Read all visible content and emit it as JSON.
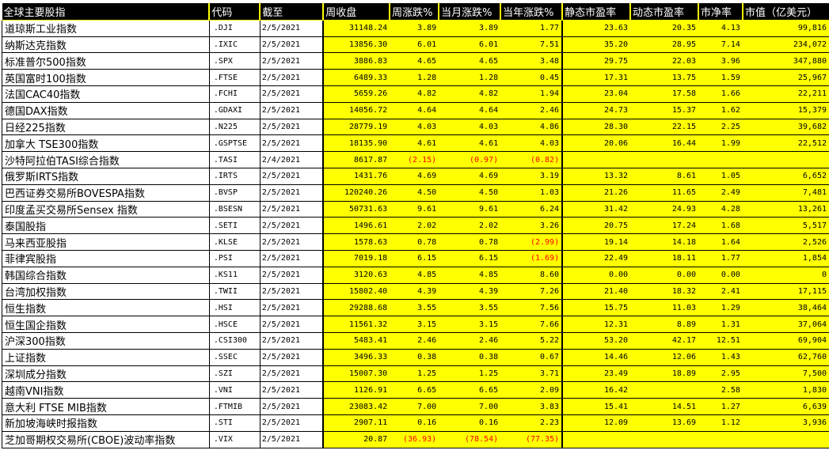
{
  "headers": [
    "全球主要股指",
    "代码",
    "截至",
    "周收盘",
    "周涨跌%",
    "当月涨跌%",
    "当年涨跌%",
    "静态市盈率",
    "动态市盈率",
    "市净率",
    "市值（亿美元）"
  ],
  "rows": [
    {
      "name": "道琼斯工业指数",
      "code": ".DJI",
      "date": "2/5/2021",
      "close": "31148.24",
      "week": "3.89",
      "month": "3.89",
      "year": "1.77",
      "pe": "23.63",
      "fpe": "20.35",
      "pb": "4.13",
      "cap": "99,816"
    },
    {
      "name": "纳斯达克指数",
      "code": ".IXIC",
      "date": "2/5/2021",
      "close": "13856.30",
      "week": "6.01",
      "month": "6.01",
      "year": "7.51",
      "pe": "35.20",
      "fpe": "28.95",
      "pb": "7.14",
      "cap": "234,072"
    },
    {
      "name": "标准普尔500指数",
      "code": ".SPX",
      "date": "2/5/2021",
      "close": "3886.83",
      "week": "4.65",
      "month": "4.65",
      "year": "3.48",
      "pe": "29.75",
      "fpe": "22.03",
      "pb": "3.96",
      "cap": "347,880"
    },
    {
      "name": "英国富时100指数",
      "code": ".FTSE",
      "date": "2/5/2021",
      "close": "6489.33",
      "week": "1.28",
      "month": "1.28",
      "year": "0.45",
      "pe": "17.31",
      "fpe": "13.75",
      "pb": "1.59",
      "cap": "25,967"
    },
    {
      "name": "法国CAC40指数",
      "code": ".FCHI",
      "date": "2/5/2021",
      "close": "5659.26",
      "week": "4.82",
      "month": "4.82",
      "year": "1.94",
      "pe": "23.04",
      "fpe": "17.58",
      "pb": "1.66",
      "cap": "22,211"
    },
    {
      "name": "德国DAX指数",
      "code": ".GDAXI",
      "date": "2/5/2021",
      "close": "14056.72",
      "week": "4.64",
      "month": "4.64",
      "year": "2.46",
      "pe": "24.73",
      "fpe": "15.37",
      "pb": "1.62",
      "cap": "15,379"
    },
    {
      "name": "日经225指数",
      "code": ".N225",
      "date": "2/5/2021",
      "close": "28779.19",
      "week": "4.03",
      "month": "4.03",
      "year": "4.86",
      "pe": "28.30",
      "fpe": "22.15",
      "pb": "2.25",
      "cap": "39,682"
    },
    {
      "name": "加拿大 TSE300指数",
      "code": ".GSPTSE",
      "date": "2/5/2021",
      "close": "18135.90",
      "week": "4.61",
      "month": "4.61",
      "year": "4.03",
      "pe": "20.06",
      "fpe": "16.44",
      "pb": "1.99",
      "cap": "22,512"
    },
    {
      "name": "沙特阿拉伯TASI综合指数",
      "code": ".TASI",
      "date": "2/4/2021",
      "close": "8617.87",
      "week": "(2.15)",
      "month": "(0.97)",
      "year": "(0.82)",
      "pe": "",
      "fpe": "",
      "pb": "",
      "cap": ""
    },
    {
      "name": "俄罗斯IRTS指数",
      "code": ".IRTS",
      "date": "2/5/2021",
      "close": "1431.76",
      "week": "4.69",
      "month": "4.69",
      "year": "3.19",
      "pe": "13.32",
      "fpe": "8.61",
      "pb": "1.05",
      "cap": "6,652"
    },
    {
      "name": "巴西证券交易所BOVESPA指数",
      "code": ".BVSP",
      "date": "2/5/2021",
      "close": "120240.26",
      "week": "4.50",
      "month": "4.50",
      "year": "1.03",
      "pe": "21.26",
      "fpe": "11.65",
      "pb": "2.49",
      "cap": "7,481"
    },
    {
      "name": "印度孟买交易所Sensex 指数",
      "code": ".BSESN",
      "date": "2/5/2021",
      "close": "50731.63",
      "week": "9.61",
      "month": "9.61",
      "year": "6.24",
      "pe": "31.42",
      "fpe": "24.93",
      "pb": "4.28",
      "cap": "13,261"
    },
    {
      "name": "泰国股指",
      "code": ".SETI",
      "date": "2/5/2021",
      "close": "1496.61",
      "week": "2.02",
      "month": "2.02",
      "year": "3.26",
      "pe": "20.75",
      "fpe": "17.24",
      "pb": "1.68",
      "cap": "5,517"
    },
    {
      "name": "马来西亚股指",
      "code": ".KLSE",
      "date": "2/5/2021",
      "close": "1578.63",
      "week": "0.78",
      "month": "0.78",
      "year": "(2.99)",
      "pe": "19.14",
      "fpe": "14.18",
      "pb": "1.64",
      "cap": "2,526"
    },
    {
      "name": "菲律宾股指",
      "code": ".PSI",
      "date": "2/5/2021",
      "close": "7019.18",
      "week": "6.15",
      "month": "6.15",
      "year": "(1.69)",
      "pe": "22.49",
      "fpe": "18.11",
      "pb": "1.77",
      "cap": "1,854"
    },
    {
      "name": "韩国综合指数",
      "code": ".KS11",
      "date": "2/5/2021",
      "close": "3120.63",
      "week": "4.85",
      "month": "4.85",
      "year": "8.60",
      "pe": "0.00",
      "fpe": "0.00",
      "pb": "0.00",
      "cap": "0"
    },
    {
      "name": "台湾加权指数",
      "code": ".TWII",
      "date": "2/5/2021",
      "close": "15802.40",
      "week": "4.39",
      "month": "4.39",
      "year": "7.26",
      "pe": "21.40",
      "fpe": "18.32",
      "pb": "2.41",
      "cap": "17,115"
    },
    {
      "name": "恒生指数",
      "code": ".HSI",
      "date": "2/5/2021",
      "close": "29288.68",
      "week": "3.55",
      "month": "3.55",
      "year": "7.56",
      "pe": "15.75",
      "fpe": "11.03",
      "pb": "1.29",
      "cap": "38,464"
    },
    {
      "name": "恒生国企指数",
      "code": ".HSCE",
      "date": "2/5/2021",
      "close": "11561.32",
      "week": "3.15",
      "month": "3.15",
      "year": "7.66",
      "pe": "12.31",
      "fpe": "8.89",
      "pb": "1.31",
      "cap": "37,064"
    },
    {
      "name": "沪深300指数",
      "code": ".CSI300",
      "date": "2/5/2021",
      "close": "5483.41",
      "week": "2.46",
      "month": "2.46",
      "year": "5.22",
      "pe": "53.20",
      "fpe": "42.17",
      "pb": "12.51",
      "cap": "69,904"
    },
    {
      "name": "上证指数",
      "code": ".SSEC",
      "date": "2/5/2021",
      "close": "3496.33",
      "week": "0.38",
      "month": "0.38",
      "year": "0.67",
      "pe": "14.46",
      "fpe": "12.06",
      "pb": "1.43",
      "cap": "62,760"
    },
    {
      "name": "深圳成分指数",
      "code": ".SZI",
      "date": "2/5/2021",
      "close": "15007.30",
      "week": "1.25",
      "month": "1.25",
      "year": "3.71",
      "pe": "23.49",
      "fpe": "18.89",
      "pb": "2.95",
      "cap": "7,500"
    },
    {
      "name": "越南VNI指数",
      "code": ".VNI",
      "date": "2/5/2021",
      "close": "1126.91",
      "week": "6.65",
      "month": "6.65",
      "year": "2.09",
      "pe": "16.42",
      "fpe": "",
      "pb": "2.58",
      "cap": "1,830"
    },
    {
      "name": "意大利 FTSE MIB指数",
      "code": ".FTMIB",
      "date": "2/5/2021",
      "close": "23083.42",
      "week": "7.00",
      "month": "7.00",
      "year": "3.83",
      "pe": "15.41",
      "fpe": "14.51",
      "pb": "1.27",
      "cap": "6,639"
    },
    {
      "name": "新加坡海峡时报指数",
      "code": ".STI",
      "date": "2/5/2021",
      "close": "2907.11",
      "week": "0.16",
      "month": "0.16",
      "year": "2.23",
      "pe": "12.09",
      "fpe": "13.69",
      "pb": "1.12",
      "cap": "3,936"
    },
    {
      "name": "芝加哥期权交易所(CBOE)波动率指数",
      "code": ".VIX",
      "date": "2/5/2021",
      "close": "20.87",
      "week": "(36.93)",
      "month": "(78.54)",
      "year": "(77.35)",
      "pe": "",
      "fpe": "",
      "pb": "",
      "cap": ""
    }
  ],
  "colors": {
    "header_bg": "#000000",
    "header_text": "#ffffff",
    "data_bg": "#ffff00",
    "negative": "#ff0000"
  }
}
